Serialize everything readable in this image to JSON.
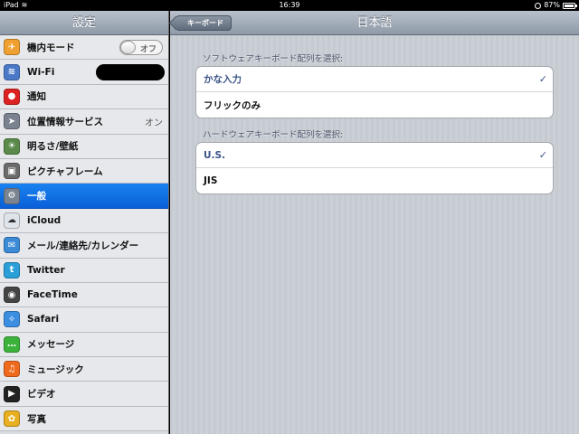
{
  "status": {
    "device": "iPad",
    "time": "16:39",
    "battery": "87%",
    "battery_fill": 0.87
  },
  "sidebar": {
    "title": "設定",
    "items": [
      {
        "label": "機内モード",
        "icon": "airplane-icon",
        "color": "#f0a030",
        "glyph": "✈",
        "toggle": "オフ"
      },
      {
        "label": "Wi-Fi",
        "icon": "wifi-icon",
        "color": "#4a79c8",
        "glyph": "≋",
        "redacted": true
      },
      {
        "label": "通知",
        "icon": "notifications-icon",
        "color": "#d22",
        "glyph": "●"
      },
      {
        "label": "位置情報サービス",
        "icon": "location-icon",
        "color": "#7a8290",
        "glyph": "➤",
        "value": "オン"
      },
      {
        "label": "明るさ/壁紙",
        "icon": "brightness-icon",
        "color": "#5a8a4a",
        "glyph": "☀"
      },
      {
        "label": "ピクチャフレーム",
        "icon": "picture-frame-icon",
        "color": "#6b6b6b",
        "glyph": "▣"
      },
      {
        "label": "一般",
        "icon": "gear-icon",
        "color": "#7b8592",
        "glyph": "⚙",
        "selected": true
      },
      {
        "label": "iCloud",
        "icon": "cloud-icon",
        "color": "#dfe3ea",
        "glyph": "☁"
      },
      {
        "label": "メール/連絡先/カレンダー",
        "icon": "mail-icon",
        "color": "#3a8ad6",
        "glyph": "✉"
      },
      {
        "label": "Twitter",
        "icon": "twitter-icon",
        "color": "#2a9fd8",
        "glyph": "t"
      },
      {
        "label": "FaceTime",
        "icon": "facetime-icon",
        "color": "#444",
        "glyph": "◉"
      },
      {
        "label": "Safari",
        "icon": "safari-icon",
        "color": "#3c8ee0",
        "glyph": "✧"
      },
      {
        "label": "メッセージ",
        "icon": "messages-icon",
        "color": "#3bb33b",
        "glyph": "…"
      },
      {
        "label": "ミュージック",
        "icon": "music-icon",
        "color": "#f06a1e",
        "glyph": "♫"
      },
      {
        "label": "ビデオ",
        "icon": "video-icon",
        "color": "#222",
        "glyph": "▶"
      },
      {
        "label": "写真",
        "icon": "photos-icon",
        "color": "#e8b020",
        "glyph": "✿"
      }
    ]
  },
  "nav": {
    "title": "日本語",
    "back_label": "キーボード"
  },
  "software": {
    "label": "ソフトウェアキーボード配列を選択:",
    "options": [
      {
        "label": "かな入力",
        "checked": true
      },
      {
        "label": "フリックのみ",
        "checked": false
      }
    ]
  },
  "hardware": {
    "label": "ハードウェアキーボード配列を選択:",
    "options": [
      {
        "label": "U.S.",
        "checked": true
      },
      {
        "label": "JIS",
        "checked": false
      }
    ]
  },
  "check_glyph": "✓"
}
